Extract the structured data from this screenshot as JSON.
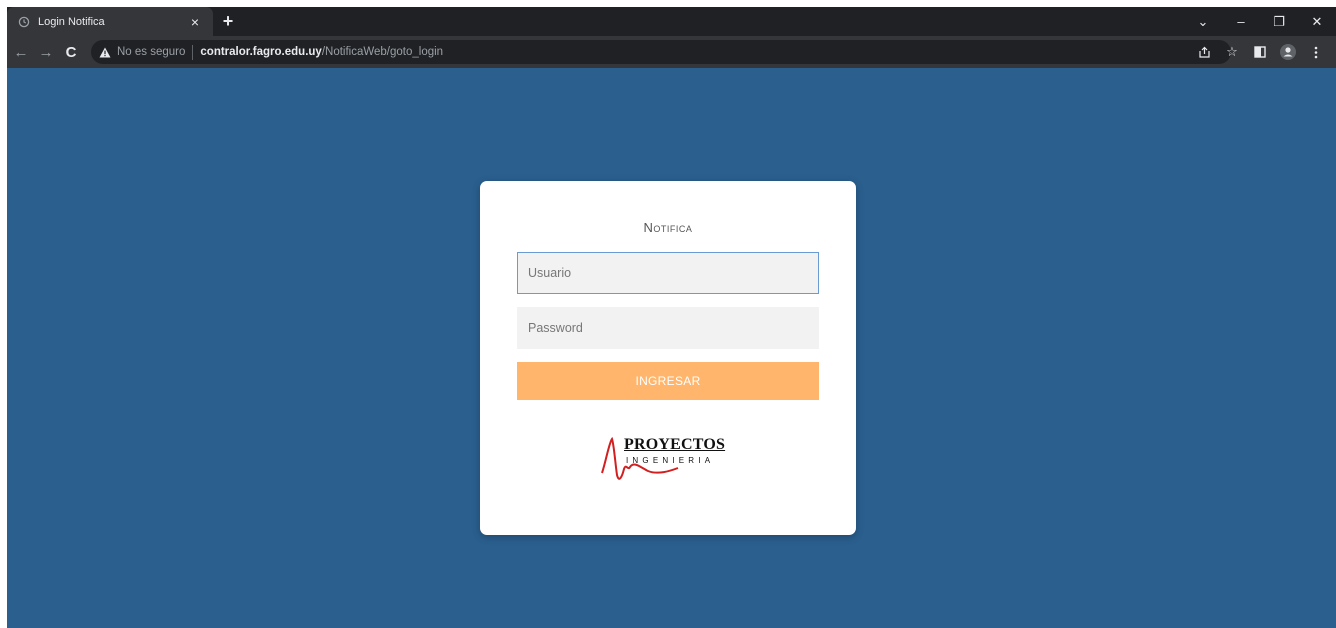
{
  "browser": {
    "tab": {
      "title": "Login Notifica",
      "close_glyph": "×",
      "favicon": "clock-icon"
    },
    "new_tab_glyph": "+",
    "window_controls": {
      "dropdown": "⌄",
      "minimize": "–",
      "restore": "❐",
      "close": "✕"
    },
    "nav": {
      "back": "←",
      "forward": "→",
      "reload": "C"
    },
    "omnibox": {
      "security_text": "No es seguro",
      "url_host": "contralor.fagro.edu.uy",
      "url_path": "/NotificaWeb/goto_login"
    },
    "toolbar_icons": [
      "share-icon",
      "star-icon",
      "side-panel-icon",
      "profile-icon",
      "menu-icon"
    ],
    "colors": {
      "frame": "#202124",
      "toolbar": "#35363a"
    }
  },
  "page": {
    "background": "#2a5f8e",
    "login": {
      "title": "Notifica",
      "username_placeholder": "Usuario",
      "password_placeholder": "Password",
      "submit_label": "INGRESAR",
      "submit_color": "#ffb56b"
    },
    "logo": {
      "main": "PROYECTOS",
      "sub": "INGENIERIA"
    }
  }
}
